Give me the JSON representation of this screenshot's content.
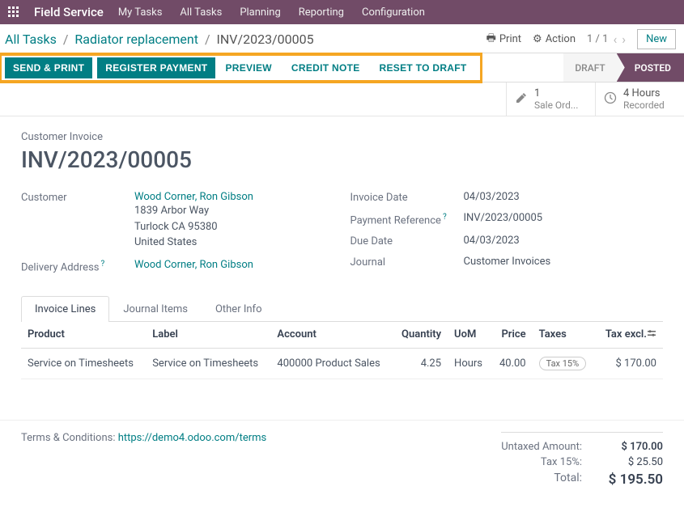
{
  "navbar": {
    "brand": "Field Service",
    "menu": [
      "My Tasks",
      "All Tasks",
      "Planning",
      "Reporting",
      "Configuration"
    ]
  },
  "controlbar": {
    "breadcrumbs": [
      "All Tasks",
      "Radiator replacement",
      "INV/2023/00005"
    ],
    "print": "Print",
    "action": "Action",
    "pager": "1 / 1",
    "new": "New"
  },
  "statusbar": {
    "send_print": "SEND & PRINT",
    "register_payment": "REGISTER PAYMENT",
    "preview": "PREVIEW",
    "credit_note": "CREDIT NOTE",
    "reset_to_draft": "RESET TO DRAFT",
    "draft": "DRAFT",
    "posted": "POSTED"
  },
  "smart": {
    "sale_count": "1",
    "sale_label": "Sale Ord...",
    "hours_count": "4 Hours",
    "hours_label": "Recorded"
  },
  "form": {
    "section_label": "Customer Invoice",
    "title": "INV/2023/00005",
    "customer_label": "Customer",
    "customer_name": "Wood Corner, Ron Gibson",
    "addr1": "1839 Arbor Way",
    "addr2": "Turlock CA 95380",
    "addr3": "United States",
    "delivery_label": "Delivery Address",
    "delivery_value": "Wood Corner, Ron Gibson",
    "invoice_date_label": "Invoice Date",
    "invoice_date": "04/03/2023",
    "payref_label": "Payment Reference",
    "payref": "INV/2023/00005",
    "due_label": "Due Date",
    "due": "04/03/2023",
    "journal_label": "Journal",
    "journal": "Customer Invoices"
  },
  "tabs": {
    "invoice_lines": "Invoice Lines",
    "journal_items": "Journal Items",
    "other_info": "Other Info"
  },
  "table": {
    "headers": {
      "product": "Product",
      "label": "Label",
      "account": "Account",
      "quantity": "Quantity",
      "uom": "UoM",
      "price": "Price",
      "taxes": "Taxes",
      "tax_excl": "Tax excl."
    },
    "rows": [
      {
        "product": "Service on Timesheets",
        "label": "Service on Timesheets",
        "account": "400000 Product Sales",
        "quantity": "4.25",
        "uom": "Hours",
        "price": "40.00",
        "taxes": "Tax 15%",
        "tax_excl": "$ 170.00"
      }
    ]
  },
  "footer": {
    "terms_label": "Terms & Conditions: ",
    "terms_url": "https://demo4.odoo.com/terms",
    "untaxed_label": "Untaxed Amount:",
    "untaxed": "$ 170.00",
    "tax_label": "Tax 15%:",
    "tax": "$ 25.50",
    "total_label": "Total:",
    "total": "$ 195.50"
  }
}
